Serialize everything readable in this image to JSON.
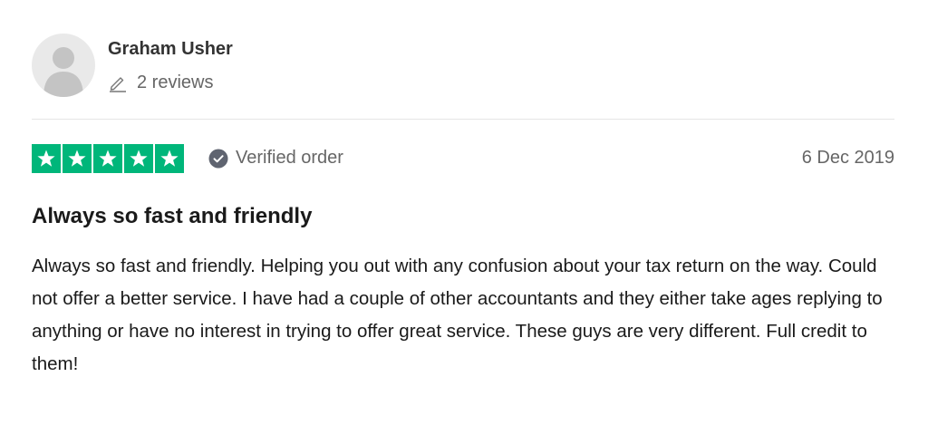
{
  "reviewer": {
    "name": "Graham Usher",
    "review_count": "2 reviews",
    "avatar_icon": "user-silhouette-icon"
  },
  "rating": {
    "stars": 5,
    "max_stars": 5,
    "color": "#00b67a",
    "star_icon": "star-icon"
  },
  "verification": {
    "label": "Verified order",
    "icon": "check-circle-icon"
  },
  "review": {
    "date": "6 Dec 2019",
    "title": "Always so fast and friendly",
    "body": "Always so fast and friendly. Helping you out with any confusion about your tax return on the way. Could not offer a better service. I have had a couple of other accountants and they either take ages replying to anything or have no interest in trying to offer great service. These guys are very different. Full credit to them!"
  },
  "colors": {
    "star_bg": "#00b67a",
    "muted_text": "#666666",
    "primary_text": "#1a1a1a",
    "divider": "#e5e5e5"
  }
}
